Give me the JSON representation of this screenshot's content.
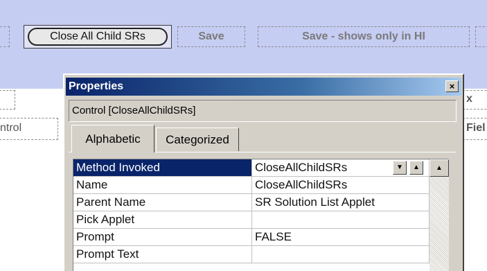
{
  "canvas": {
    "selected_button_label": "Close All Child SRs",
    "save_label": "Save",
    "save_hi_label": "Save - shows only in HI",
    "left_edge_label": "ntrol",
    "right_edge_label_top": "x",
    "right_edge_label": "Fiel"
  },
  "properties_window": {
    "title": "Properties",
    "close_glyph": "×",
    "object_selector": "Control [CloseAllChildSRs]",
    "tabs": [
      {
        "label": "Alphabetic",
        "active": true
      },
      {
        "label": "Categorized",
        "active": false
      }
    ],
    "rows": [
      {
        "name": "Method Invoked",
        "value": "CloseAllChildSRs",
        "selected": true
      },
      {
        "name": "Name",
        "value": "CloseAllChildSRs",
        "selected": false
      },
      {
        "name": "Parent Name",
        "value": "SR Solution List Applet",
        "selected": false
      },
      {
        "name": "Pick Applet",
        "value": "",
        "selected": false
      },
      {
        "name": "Prompt",
        "value": "FALSE",
        "selected": false
      },
      {
        "name": "Prompt Text",
        "value": "",
        "selected": false
      }
    ],
    "dropdown_glyph": "▼",
    "scroll_up_glyph": "▲"
  }
}
